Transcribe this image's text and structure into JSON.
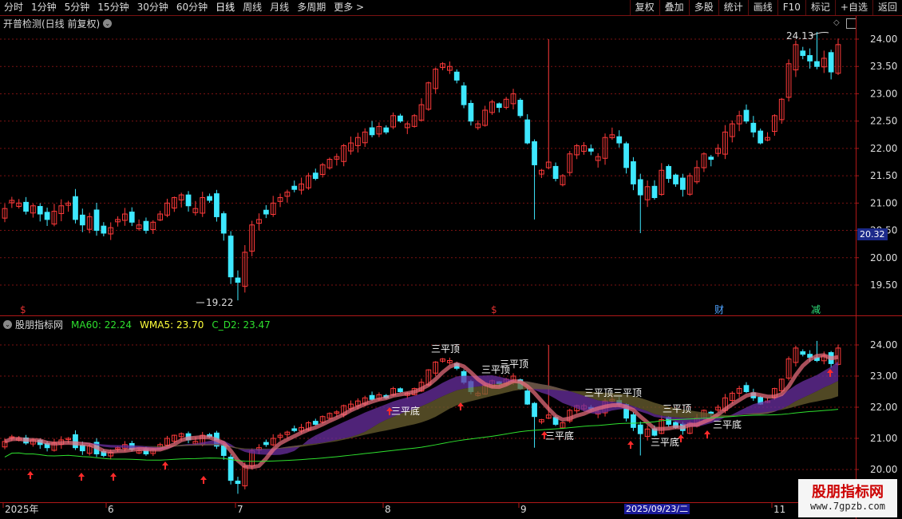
{
  "toolbar": {
    "periods": [
      "分时",
      "1分钟",
      "5分钟",
      "15分钟",
      "30分钟",
      "60分钟",
      "日线",
      "周线",
      "月线",
      "多周期",
      "更多 >"
    ],
    "actions": [
      "复权",
      "叠加",
      "多股",
      "统计",
      "画线",
      "F10",
      "标记",
      "+自选",
      "返回"
    ]
  },
  "main_panel": {
    "title": "开普检测(日线 前复权)",
    "y_ticks": [
      "24.00",
      "23.50",
      "23.00",
      "22.50",
      "22.00",
      "21.50",
      "21.00",
      "20.50",
      "20.00",
      "19.50"
    ],
    "high_label": "24.13",
    "low_label": "19.22",
    "current_price": "20.32",
    "event_markers": [
      {
        "text": "$",
        "color": "#e03030"
      },
      {
        "text": "$",
        "color": "#e03030"
      },
      {
        "text": "财",
        "color": "#4fa3ff"
      },
      {
        "text": "减",
        "color": "#2ee07a"
      }
    ]
  },
  "indicator_panel": {
    "name": "股朋指标网",
    "legend": [
      {
        "text": "MA60: 22.24",
        "color": "#2ee02e"
      },
      {
        "text": "WMA5: 23.70",
        "color": "#ffff3a"
      },
      {
        "text": "C_D2: 23.47",
        "color": "#2ee02e"
      }
    ],
    "y_ticks": [
      "24.00",
      "23.00",
      "22.00",
      "21.00",
      "20.00"
    ],
    "annotations": [
      "三平顶",
      "三平顶",
      "三平顶",
      "三平顶",
      "三平顶",
      "三平顶",
      "三平底",
      "三平底",
      "三平底",
      "三平底"
    ]
  },
  "x_axis": {
    "labels": [
      "2025年",
      "6",
      "7",
      "8",
      "9",
      "11"
    ],
    "highlight_date": "2025/09/23/二"
  },
  "watermark": {
    "title": "股朋指标网",
    "url": "www.7gpzb.com"
  },
  "colors": {
    "up": "#ff3a3a",
    "down": "#3ee8ff",
    "grid": "#7a1212",
    "axis": "#b01818"
  },
  "chart_data": {
    "type": "candlestick",
    "title": "开普检测(日线 前复权)",
    "ylim": [
      19.0,
      24.4
    ],
    "series_close": [
      20.9,
      21.05,
      21.0,
      20.85,
      20.95,
      20.8,
      20.7,
      20.85,
      20.95,
      21.0,
      20.7,
      20.6,
      20.75,
      20.5,
      20.45,
      20.55,
      20.7,
      20.8,
      20.65,
      20.6,
      20.5,
      20.65,
      20.8,
      21.0,
      21.1,
      21.15,
      20.95,
      20.9,
      21.1,
      21.05,
      20.75,
      20.45,
      19.65,
      19.55,
      20.1,
      20.6,
      20.7,
      20.8,
      21.0,
      21.1,
      21.2,
      21.25,
      21.35,
      21.5,
      21.45,
      21.7,
      21.8,
      21.85,
      22.05,
      22.1,
      22.2,
      22.3,
      22.25,
      22.4,
      22.3,
      22.6,
      22.5,
      22.45,
      22.6,
      22.8,
      23.2,
      23.45,
      23.55,
      23.5,
      23.25,
      22.8,
      22.5,
      22.45,
      22.7,
      22.85,
      22.75,
      22.9,
      23.0,
      22.6,
      22.1,
      21.7,
      21.6,
      21.75,
      21.45,
      21.5,
      21.9,
      22.05,
      22.05,
      21.95,
      21.85,
      22.2,
      22.25,
      22.1,
      21.65,
      21.35,
      21.15,
      21.3,
      21.1,
      21.6,
      21.45,
      21.35,
      21.25,
      21.5,
      21.65,
      21.9,
      21.8,
      22.0,
      22.3,
      22.45,
      22.6,
      22.5,
      22.3,
      22.1,
      22.2,
      22.6,
      22.9,
      23.55,
      23.9,
      23.7,
      23.6,
      23.5,
      23.65,
      23.4,
      23.9
    ]
  }
}
